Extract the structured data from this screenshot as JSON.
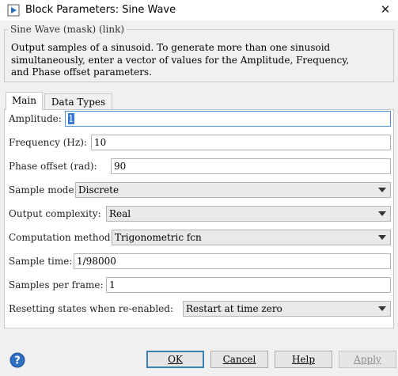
{
  "window": {
    "title": "Block Parameters: Sine Wave"
  },
  "mask": {
    "title": "Sine Wave (mask) (link)",
    "description": "Output samples of a sinusoid.  To generate more than one sinusoid\nsimultaneously, enter a vector of values for the Amplitude, Frequency,\nand Phase offset parameters."
  },
  "tabs": [
    {
      "label": "Main",
      "active": true
    },
    {
      "label": "Data Types",
      "active": false
    }
  ],
  "params": {
    "amplitude": {
      "label": "Amplitude:",
      "value": "1"
    },
    "frequency": {
      "label": "Frequency (Hz):",
      "value": "10"
    },
    "phase": {
      "label": "Phase offset (rad):",
      "value": "90"
    },
    "sample_mode": {
      "label": "Sample mode:",
      "value": "Discrete"
    },
    "output_complexity": {
      "label": "Output complexity:",
      "value": "Real"
    },
    "computation_method": {
      "label": "Computation method:",
      "value": "Trigonometric fcn"
    },
    "sample_time": {
      "label": "Sample time:",
      "value": "1/98000"
    },
    "samples_per_frame": {
      "label": "Samples per frame:",
      "value": "1"
    },
    "resetting_states": {
      "label": "Resetting states when re-enabled:",
      "value": "Restart at time zero"
    }
  },
  "buttons": {
    "ok": "OK",
    "cancel": "Cancel",
    "help": "Help",
    "apply": "Apply"
  },
  "colors": {
    "focus_border": "#4a90d9",
    "selection": "#3a78d4",
    "default_button_border": "#3c7fb1"
  },
  "icons": {
    "title": "simulink-block-icon",
    "close": "close-icon",
    "help": "help-question-icon",
    "dropdown": "chevron-down-icon"
  }
}
